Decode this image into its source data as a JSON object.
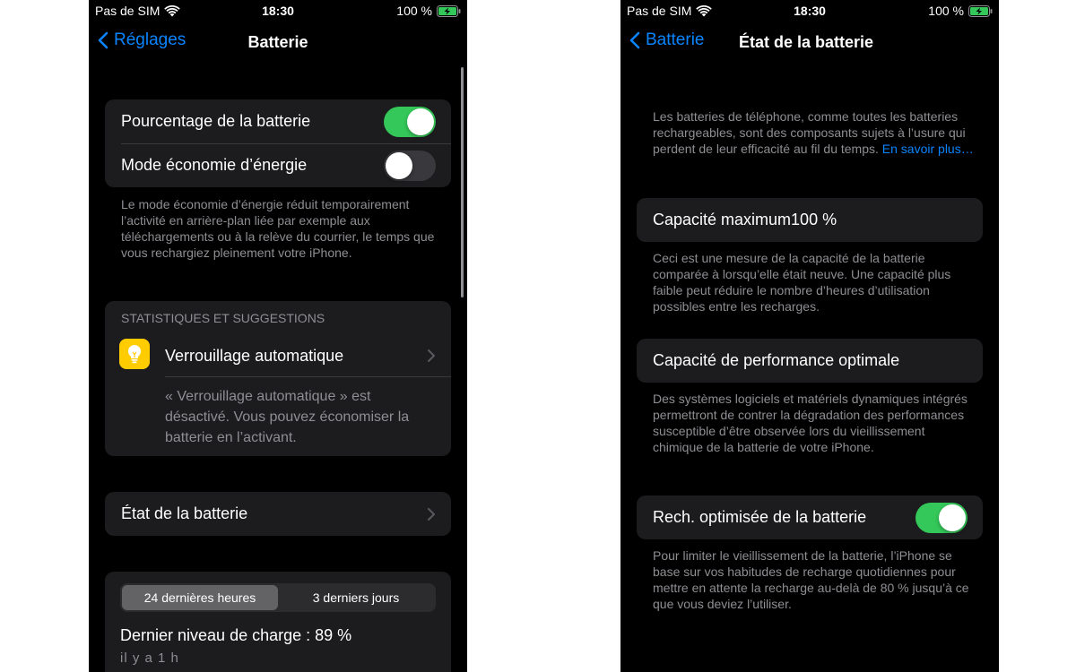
{
  "colors": {
    "accent": "#0a84ff",
    "toggle_on": "#34c759",
    "toggle_off": "#39393d",
    "cell_background": "#1c1c1e",
    "secondary_text": "#8e8e93",
    "bulb_icon_background": "#ffcc00"
  },
  "left": {
    "status": {
      "carrier": "Pas de SIM",
      "time": "18:30",
      "battery": "100 %"
    },
    "nav": {
      "back": "Réglages",
      "title": "Batterie"
    },
    "settings": [
      {
        "label": "Pourcentage de la batterie",
        "on": true
      },
      {
        "label": "Mode économie d’énergie",
        "on": false
      }
    ],
    "low_power_footer": "Le mode économie d’énergie réduit temporairement l’activité en arrière-plan liée par exemple aux téléchargements ou à la relève du courrier, le temps que vous rechargiez pleinement votre iPhone.",
    "stats": {
      "header": "STATISTIQUES ET SUGGESTIONS",
      "item_label": "Verrouillage automatique",
      "item_icon": "lightbulb-icon",
      "item_description": "« Verrouillage automatique » est désactivé. Vous pouvez économiser la batterie en l’activant."
    },
    "battery_health_row": "État de la batterie",
    "usage": {
      "segments": [
        "24 dernières heures",
        "3 derniers jours"
      ],
      "selected_segment": "24 dernières heures",
      "last_charge": "Dernier niveau de charge : 89 %",
      "last_charge_time": "il y a 1 h"
    }
  },
  "right": {
    "status": {
      "carrier": "Pas de SIM",
      "time": "18:30",
      "battery": "100 %"
    },
    "nav": {
      "back": "Batterie",
      "title": "État de la batterie"
    },
    "intro": "Les batteries de téléphone, comme toutes les batteries rechargeables, sont des composants sujets à l’usure qui perdent de leur efficacité au fil du temps.",
    "intro_link": "En savoir plus…",
    "max_capacity": {
      "label": "Capacité maximum",
      "value": "100 %"
    },
    "max_capacity_footer": "Ceci est une mesure de la capacité de la batterie comparée à lorsqu’elle était neuve. Une capacité plus faible peut réduire le nombre d’heures d’utilisation possibles entre les recharges.",
    "peak_performance": {
      "label": "Capacité de performance optimale"
    },
    "peak_performance_footer": "Des systèmes logiciels et matériels dynamiques intégrés permettront de contrer la dégradation des performances susceptible d’être observée lors du vieillissement chimique de la batterie de votre iPhone.",
    "optimized_charging": {
      "label": "Rech. optimisée de la batterie",
      "on": true
    },
    "optimized_charging_footer": "Pour limiter le vieillissement de la batterie, l’iPhone se base sur vos habitudes de recharge quotidiennes pour mettre en attente la recharge au-delà de 80 % jusqu’à ce que vous deviez l’utiliser."
  }
}
